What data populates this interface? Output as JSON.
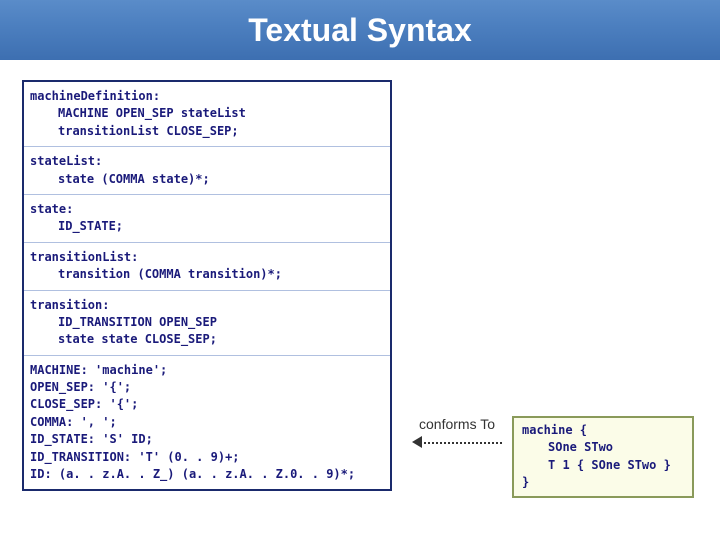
{
  "header": {
    "title": "Textual Syntax"
  },
  "grammar": {
    "r1": {
      "name": "machineDefinition:",
      "l1": "MACHINE OPEN_SEP stateList",
      "l2": "transitionList CLOSE_SEP;"
    },
    "r2": {
      "name": "stateList:",
      "l1": "state (COMMA state)*;"
    },
    "r3": {
      "name": "state:",
      "l1": "ID_STATE;"
    },
    "r4": {
      "name": "transitionList:",
      "l1": "transition (COMMA transition)*;"
    },
    "r5": {
      "name": "transition:",
      "l1": "ID_TRANSITION OPEN_SEP",
      "l2": "state state CLOSE_SEP;"
    },
    "r6": {
      "l1": "MACHINE: 'machine';",
      "l2": "OPEN_SEP: '{';",
      "l3": "CLOSE_SEP: '{';",
      "l4": "COMMA: ', ';",
      "l5": "ID_STATE: 'S' ID;",
      "l6": "ID_TRANSITION: 'T' (0. . 9)+;",
      "l7": "ID: (a. . z.A. . Z_) (a. . z.A. . Z.0. . 9)*;"
    }
  },
  "conforms": {
    "label": "conforms To"
  },
  "example": {
    "l1": "machine {",
    "l2": "SOne STwo",
    "l3": "T 1 { SOne STwo }",
    "l4": "}"
  }
}
